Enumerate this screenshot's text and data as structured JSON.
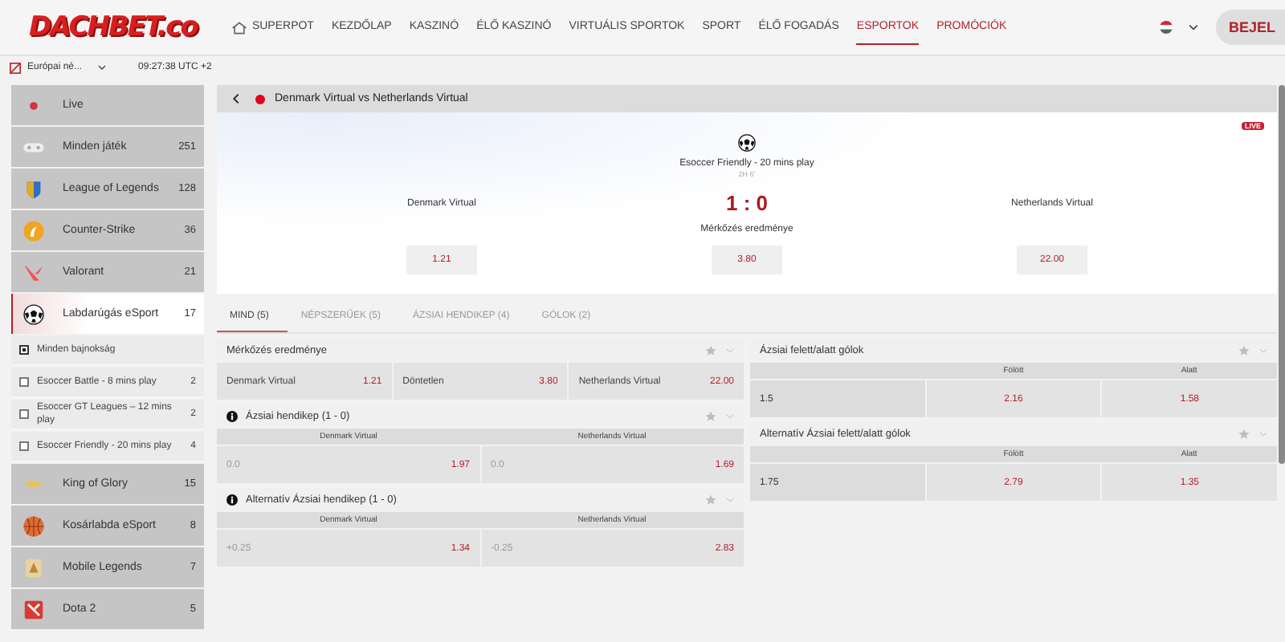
{
  "header": {
    "logo": "DACHBET.co",
    "nav": [
      {
        "label": "SUPERPOT",
        "selected": false,
        "highlighted": false,
        "kind": "icon"
      },
      {
        "label": "KEZDŐLAP",
        "selected": false,
        "highlighted": false,
        "kind": "text"
      },
      {
        "label": "KASZINÓ",
        "selected": false,
        "highlighted": false,
        "kind": "text"
      },
      {
        "label": "ÉLŐ KASZINÓ",
        "selected": false,
        "highlighted": false,
        "kind": "text"
      },
      {
        "label": "VIRTUÁLIS SPORTOK",
        "selected": false,
        "highlighted": false,
        "kind": "text"
      },
      {
        "label": "SPORT",
        "selected": false,
        "highlighted": false,
        "kind": "text"
      },
      {
        "label": "ÉLŐ FOGADÁS",
        "selected": false,
        "highlighted": false,
        "kind": "text"
      },
      {
        "label": "ESPORTOK",
        "selected": true,
        "highlighted": false,
        "kind": "text"
      },
      {
        "label": "PROMÓCIÓK",
        "selected": false,
        "highlighted": true,
        "kind": "text"
      }
    ],
    "login_button": "BEJEL"
  },
  "topbar": {
    "odds_format": "Európai né...",
    "clock": "09:27:38 UTC +2"
  },
  "sidebar": {
    "items": [
      {
        "label": "Live",
        "selected": false
      },
      {
        "label": "Minden játék",
        "count": "251",
        "selected": false
      },
      {
        "label": "League of Legends",
        "count": "128",
        "selected": false
      },
      {
        "label": "Counter-Strike",
        "count": "36",
        "selected": false
      },
      {
        "label": "Valorant",
        "count": "21",
        "selected": false
      },
      {
        "label": "Labdarúgás eSport",
        "count": "17",
        "selected": true,
        "children": [
          {
            "label": "Minden bajnokság",
            "checked": true
          },
          {
            "label": "Esoccer Battle - 8 mins play",
            "count": "2",
            "checked": false
          },
          {
            "label": "Esoccer GT Leagues – 12 mins play",
            "count": "2",
            "checked": false
          },
          {
            "label": "Esoccer Friendly - 20 mins play",
            "count": "4",
            "checked": false
          }
        ]
      },
      {
        "label": "King of Glory",
        "count": "15",
        "selected": false
      },
      {
        "label": "Kosárlabda eSport",
        "count": "8",
        "selected": false
      },
      {
        "label": "Mobile Legends",
        "count": "7",
        "selected": false
      },
      {
        "label": "Dota 2",
        "count": "5",
        "selected": false
      }
    ]
  },
  "match": {
    "title": "Denmark Virtual vs Netherlands Virtual",
    "live_badge": "LIVE",
    "competition": "Esoccer Friendly - 20 mins play",
    "period": "2H 6'",
    "home": "Denmark Virtual",
    "away": "Netherlands Virtual",
    "score": "1 : 0",
    "market": "Mérkőzés eredménye",
    "odds": [
      "1.21",
      "3.80",
      "22.00"
    ]
  },
  "tabs": [
    {
      "label": "MIND (5)",
      "selected": true
    },
    {
      "label": "NÉPSZERŰEK (5)",
      "selected": false
    },
    {
      "label": "ÁZSIAI HENDIKEP (4)",
      "selected": false
    },
    {
      "label": "GÓLOK (2)",
      "selected": false
    }
  ],
  "markets_left": [
    {
      "kind": "three_way",
      "title": "Mérkőzés eredménye",
      "info": false,
      "selections": [
        {
          "name": "Denmark Virtual",
          "odds": "1.21"
        },
        {
          "name": "Döntetlen",
          "odds": "3.80"
        },
        {
          "name": "Netherlands Virtual",
          "odds": "22.00"
        }
      ]
    },
    {
      "kind": "handicap",
      "title": "Ázsiai hendikep  (1 - 0)",
      "info": true,
      "headers": [
        "Denmark Virtual",
        "Netherlands Virtual"
      ],
      "selections": [
        {
          "line": "0.0",
          "odds": "1.97"
        },
        {
          "line": "0.0",
          "odds": "1.69"
        }
      ]
    },
    {
      "kind": "handicap",
      "title": "Alternatív Ázsiai hendikep  (1 - 0)",
      "info": true,
      "headers": [
        "Denmark Virtual",
        "Netherlands Virtual"
      ],
      "selections": [
        {
          "line": "+0.25",
          "odds": "1.34"
        },
        {
          "line": "-0.25",
          "odds": "2.83"
        }
      ]
    }
  ],
  "markets_right": [
    {
      "kind": "totals",
      "title": "Ázsiai felett/alatt gólok",
      "info": false,
      "headers": [
        "Fölött",
        "Alatt"
      ],
      "line": "1.5",
      "odds": [
        "2.16",
        "1.58"
      ]
    },
    {
      "kind": "totals",
      "title": "Alternatív Ázsiai felett/alatt gólok",
      "info": false,
      "headers": [
        "Fölött",
        "Alatt"
      ],
      "line": "1.75",
      "odds": [
        "2.79",
        "1.35"
      ]
    }
  ]
}
